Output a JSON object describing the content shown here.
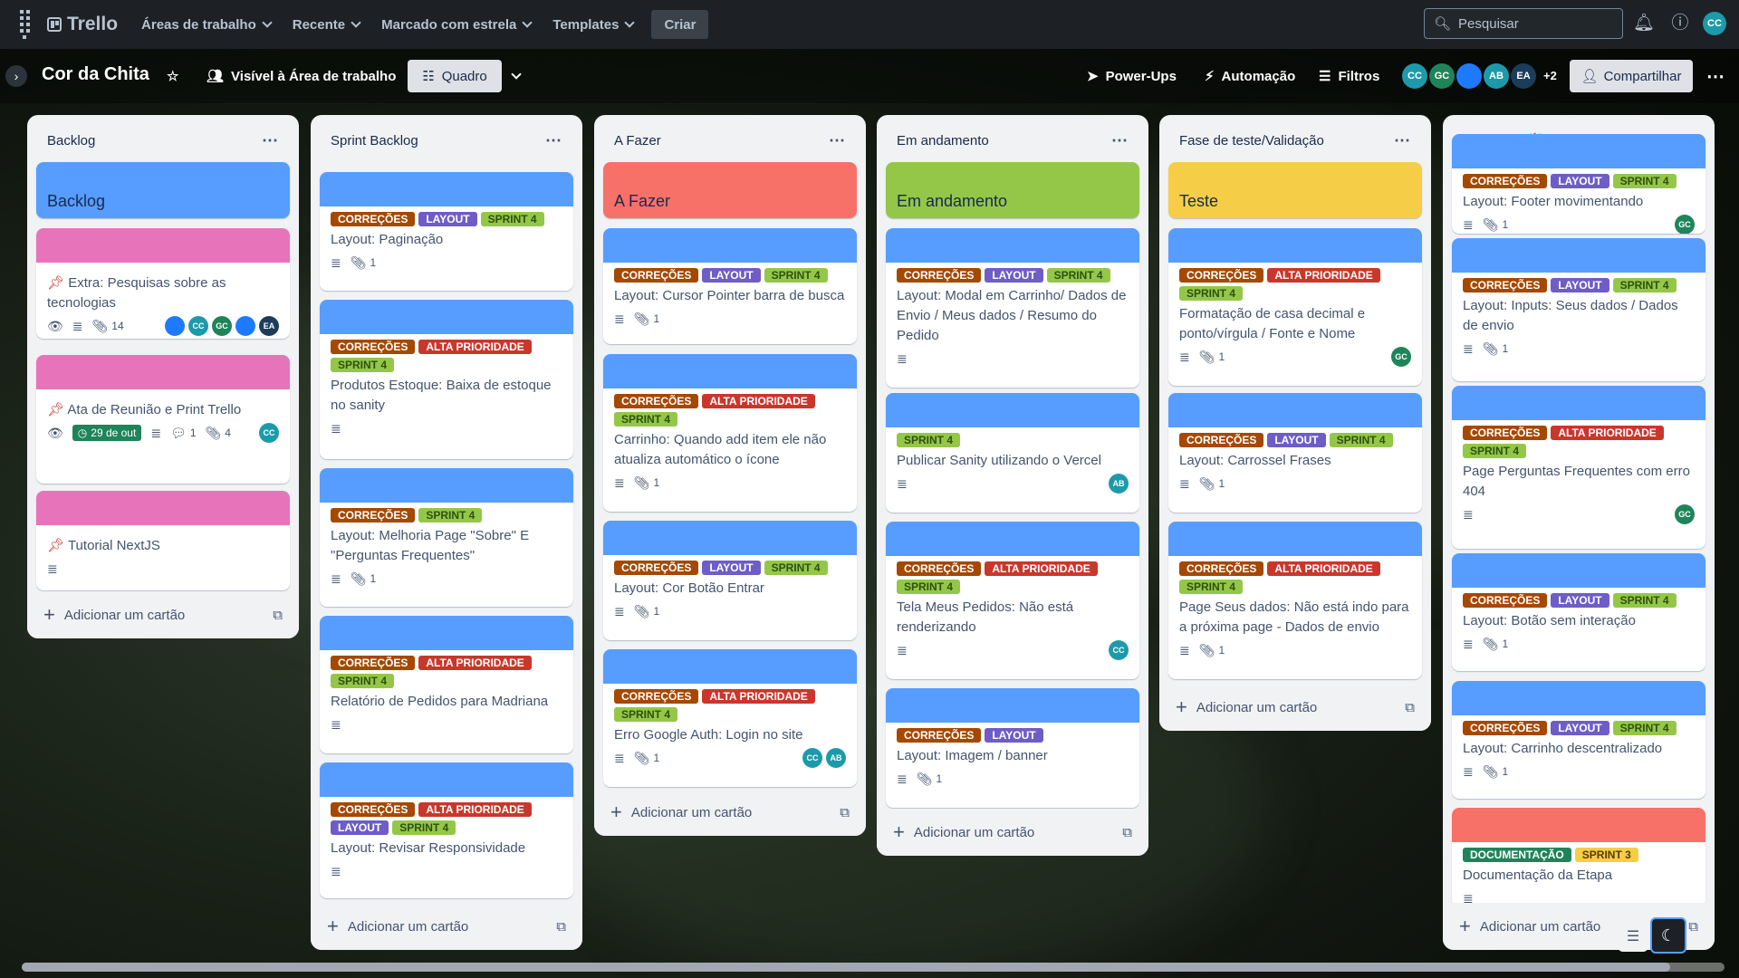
{
  "topbar": {
    "app_name": "Trello",
    "nav": [
      "Áreas de trabalho",
      "Recente",
      "Marcado com estrela",
      "Templates"
    ],
    "create": "Criar",
    "search_placeholder": "Pesquisar",
    "user_initials": "CC"
  },
  "board": {
    "title": "Cor da Chita",
    "visibility": "Visível à Área de trabalho",
    "view": "Quadro",
    "powerups": "Power-Ups",
    "automation": "Automação",
    "filters": "Filtros",
    "members": [
      "CC",
      "GC",
      "",
      "AB",
      "EA"
    ],
    "members_more": "+2",
    "share": "Compartilhar"
  },
  "add_card": "Adicionar um cartão",
  "lists": [
    {
      "name": "Backlog",
      "cover_title": "Backlog",
      "cards": [
        {
          "title": "Extra: Pesquisas sobre as tecnologias",
          "attachments": "14",
          "members": [
            "",
            "CC",
            "GC",
            "",
            "EA"
          ]
        },
        {
          "title": "Ata de Reunião e Print Trello",
          "date": "29 de out",
          "comments": "1",
          "attachments": "4",
          "members": [
            "CC"
          ]
        },
        {
          "title": "Tutorial NextJS"
        }
      ]
    },
    {
      "name": "Sprint Backlog",
      "cards": [
        {
          "labels": [
            "CORREÇÕES",
            "LAYOUT",
            "SPRINT 4"
          ],
          "title": "Layout: Paginação",
          "attachments": "1"
        },
        {
          "labels": [
            "CORREÇÕES",
            "ALTA PRIORIDADE",
            "SPRINT 4"
          ],
          "title": "Produtos Estoque: Baixa de estoque no sanity"
        },
        {
          "labels": [
            "CORREÇÕES",
            "SPRINT 4"
          ],
          "title": "Layout: Melhoria Page \"Sobre\" E \"Perguntas Frequentes\"",
          "attachments": "1"
        },
        {
          "labels": [
            "CORREÇÕES",
            "ALTA PRIORIDADE",
            "SPRINT 4"
          ],
          "title": "Relatório de Pedidos para Madriana"
        },
        {
          "labels": [
            "CORREÇÕES",
            "ALTA PRIORIDADE",
            "LAYOUT",
            "SPRINT 4"
          ],
          "title": "Layout: Revisar Responsividade"
        }
      ]
    },
    {
      "name": "A Fazer",
      "cover_title": "A Fazer",
      "cards": [
        {
          "labels": [
            "CORREÇÕES",
            "LAYOUT",
            "SPRINT 4"
          ],
          "title": "Layout: Cursor Pointer barra de busca",
          "attachments": "1"
        },
        {
          "labels": [
            "CORREÇÕES",
            "ALTA PRIORIDADE",
            "SPRINT 4"
          ],
          "title": "Carrinho: Quando add item ele não atualiza automático o ícone",
          "attachments": "1"
        },
        {
          "labels": [
            "CORREÇÕES",
            "LAYOUT",
            "SPRINT 4"
          ],
          "title": "Layout: Cor Botão Entrar",
          "attachments": "1"
        },
        {
          "labels": [
            "CORREÇÕES",
            "ALTA PRIORIDADE",
            "SPRINT 4"
          ],
          "title": "Erro Google Auth: Login no site",
          "attachments": "1",
          "members": [
            "CC",
            "AB"
          ]
        }
      ]
    },
    {
      "name": "Em andamento",
      "cover_title": "Em andamento",
      "cards": [
        {
          "labels": [
            "CORREÇÕES",
            "LAYOUT",
            "SPRINT 4"
          ],
          "title": "Layout: Modal em Carrinho/ Dados de Envio / Meus dados / Resumo do Pedido"
        },
        {
          "labels": [
            "SPRINT 4"
          ],
          "title": "Publicar Sanity utilizando o Vercel",
          "members": [
            "AB"
          ]
        },
        {
          "labels": [
            "CORREÇÕES",
            "ALTA PRIORIDADE",
            "SPRINT 4"
          ],
          "title": "Tela Meus Pedidos: Não está renderizando",
          "members": [
            "CC"
          ]
        },
        {
          "labels": [
            "CORREÇÕES",
            "LAYOUT"
          ],
          "title": "Layout: Imagem / banner",
          "attachments": "1"
        }
      ]
    },
    {
      "name": "Fase de teste/Validação",
      "cover_title": "Teste",
      "cards": [
        {
          "labels": [
            "CORREÇÕES",
            "ALTA PRIORIDADE",
            "SPRINT 4"
          ],
          "title": "Formatação de casa decimal e ponto/vírgula / Fonte e Nome",
          "attachments": "1",
          "members": [
            "GC"
          ]
        },
        {
          "labels": [
            "CORREÇÕES",
            "LAYOUT",
            "SPRINT 4"
          ],
          "title": "Layout: Carrossel Frases",
          "attachments": "1"
        },
        {
          "labels": [
            "CORREÇÕES",
            "ALTA PRIORIDADE",
            "SPRINT 4"
          ],
          "title": "Page Seus dados: Não está indo para a próxima page - Dados de envio",
          "attachments": "1"
        }
      ]
    },
    {
      "name": "Concluído 🎉",
      "cards": [
        {
          "labels": [
            "CORREÇÕES",
            "LAYOUT",
            "SPRINT 4"
          ],
          "title": "Layout: Footer movimentando",
          "attachments": "1",
          "members": [
            "GC"
          ]
        },
        {
          "labels": [
            "CORREÇÕES",
            "LAYOUT",
            "SPRINT 4"
          ],
          "title": "Layout: Inputs: Seus dados / Dados de envio",
          "attachments": "1"
        },
        {
          "labels": [
            "CORREÇÕES",
            "ALTA PRIORIDADE",
            "SPRINT 4"
          ],
          "title": "Page Perguntas Frequentes com erro 404",
          "members": [
            "GC"
          ]
        },
        {
          "labels": [
            "CORREÇÕES",
            "LAYOUT",
            "SPRINT 4"
          ],
          "title": "Layout: Botão sem interação",
          "attachments": "1"
        },
        {
          "labels": [
            "CORREÇÕES",
            "LAYOUT",
            "SPRINT 4"
          ],
          "title": "Layout: Carrinho descentralizado",
          "attachments": "1"
        },
        {
          "labels": [
            "DOCUMENTAÇÃO",
            "SPRINT 3"
          ],
          "title": "Documentação da Etapa"
        }
      ]
    }
  ],
  "colors": {
    "topbar": "#1d2125",
    "cover_blue": "#579dff",
    "cover_pink": "#e774bb",
    "cover_red": "#f87168",
    "cover_green": "#94c748",
    "cover_yellow": "#f5cd47",
    "member_teal": "#1d9aaa",
    "member_green": "#1f845a",
    "member_navy": "#1c3d5a"
  },
  "icons": {
    "apps": "grid-icon",
    "search": "search-icon",
    "notifications": "bell-icon",
    "help": "help-icon",
    "star": "star-icon",
    "visibility": "people-icon",
    "board_view": "board-icon",
    "filter": "filter-icon",
    "automation": "bolt-icon",
    "powerups": "rocket-icon",
    "share": "person-add-icon",
    "more": "dots-icon"
  }
}
